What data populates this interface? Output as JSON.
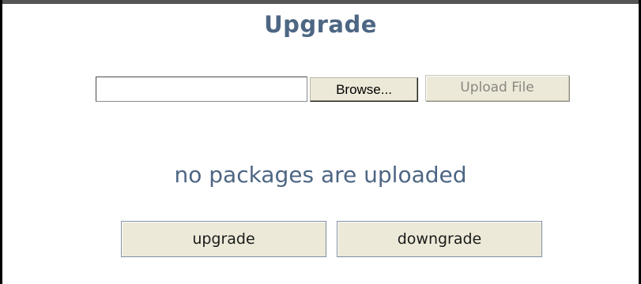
{
  "page": {
    "title": "Upgrade"
  },
  "upload": {
    "file_value": "",
    "browse_label": "Browse...",
    "upload_label": "Upload File"
  },
  "status": {
    "message": "no packages are uploaded"
  },
  "actions": {
    "upgrade_label": "upgrade",
    "downgrade_label": "downgrade"
  },
  "colors": {
    "heading": "#4d6683",
    "button_face": "#ece9d8",
    "disabled_text": "#8a8780"
  }
}
